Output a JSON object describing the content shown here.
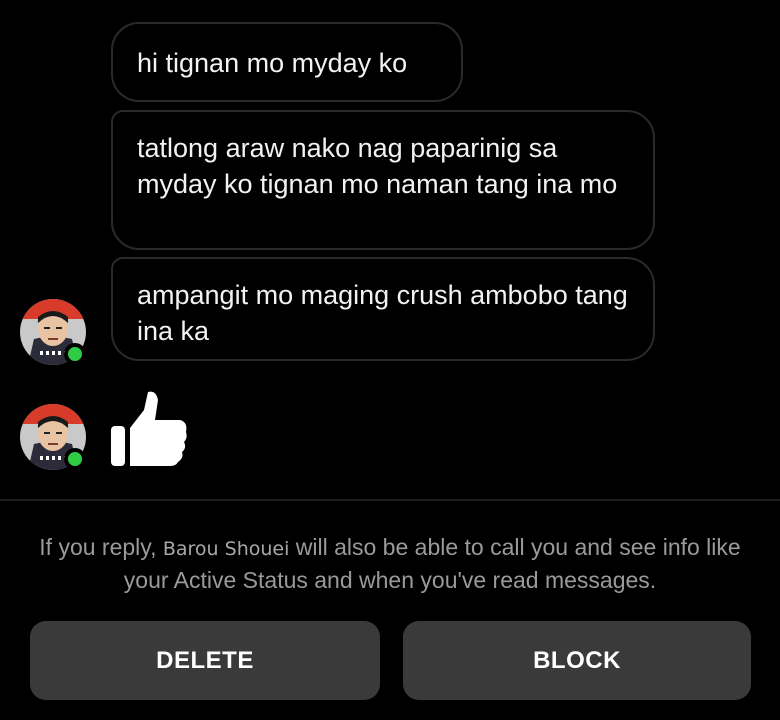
{
  "messages": [
    {
      "text": "hi tignan mo myday ko"
    },
    {
      "text": "tatlong araw nako nag paparinig sa myday ko tignan mo naman tang ina mo"
    },
    {
      "text": "ampangit mo maging crush ambobo tang ina ka"
    }
  ],
  "reaction": {
    "icon": "thumbs-up-icon"
  },
  "notice": {
    "prefix": "If you reply, ",
    "name": "Barou Shouei",
    "suffix": " will also be able to call you and see info like your Active Status and when you've read messages."
  },
  "actions": {
    "delete_label": "DELETE",
    "block_label": "BLOCK"
  },
  "colors": {
    "background": "#000000",
    "bubble_border": "#2a2a2a",
    "online": "#31cc46",
    "button_bg": "#3a3a3a",
    "notice_text": "#9a9a9a"
  }
}
